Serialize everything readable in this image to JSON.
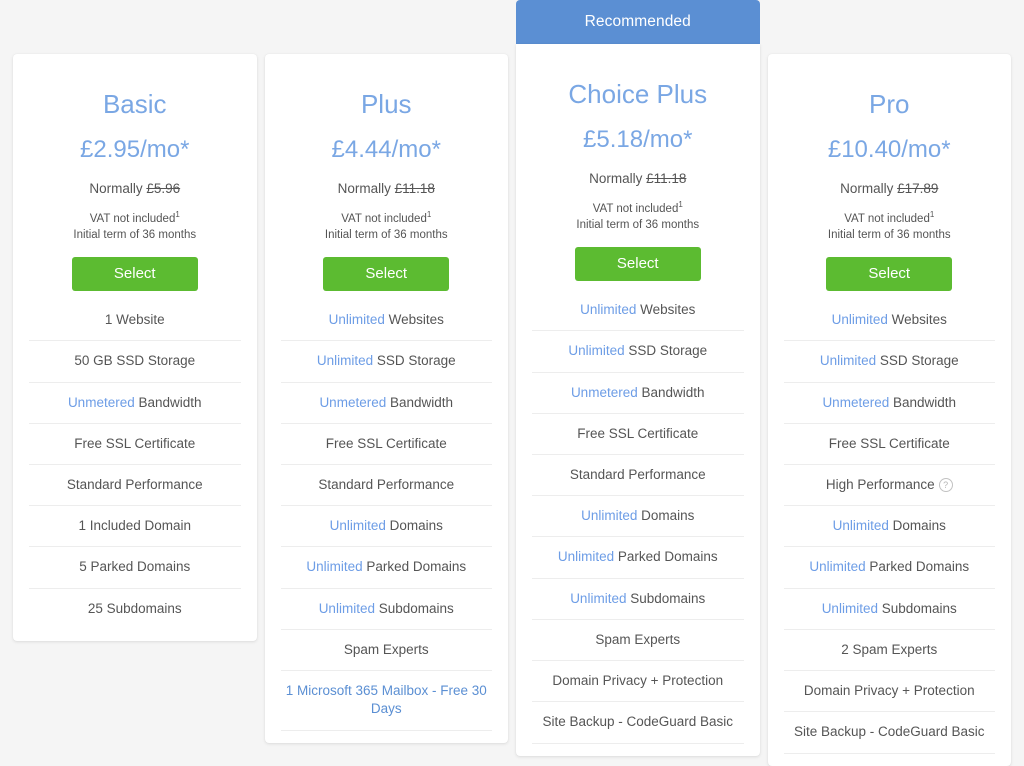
{
  "page": {
    "background_color": "#f5f5f5",
    "accent_blue": "#7aa7e4",
    "link_blue": "#6d9de6",
    "banner_blue": "#5b8fd3",
    "button_green": "#5cbb31",
    "body_text": "#555555"
  },
  "plans": [
    {
      "id": "basic",
      "name": "Basic",
      "price": "£2.95/mo*",
      "normally_label": "Normally",
      "normally_price": "£5.96",
      "vat_note": "VAT not included",
      "vat_superscript": "1",
      "term_note": "Initial term of 36 months",
      "select_label": "Select",
      "recommended": false,
      "banner_label": "",
      "features": [
        {
          "highlight": "",
          "text": "1 Website"
        },
        {
          "highlight": "",
          "text": "50 GB SSD Storage"
        },
        {
          "highlight": "Unmetered",
          "text": "Bandwidth"
        },
        {
          "highlight": "",
          "text": "Free SSL Certificate"
        },
        {
          "highlight": "",
          "text": "Standard Performance"
        },
        {
          "highlight": "",
          "text": "1 Included Domain"
        },
        {
          "highlight": "",
          "text": "5 Parked Domains"
        },
        {
          "highlight": "",
          "text": "25 Subdomains"
        }
      ]
    },
    {
      "id": "plus",
      "name": "Plus",
      "price": "£4.44/mo*",
      "normally_label": "Normally",
      "normally_price": "£11.18",
      "vat_note": "VAT not included",
      "vat_superscript": "1",
      "term_note": "Initial term of 36 months",
      "select_label": "Select",
      "recommended": false,
      "banner_label": "",
      "features": [
        {
          "highlight": "Unlimited",
          "text": "Websites"
        },
        {
          "highlight": "Unlimited",
          "text": "SSD Storage"
        },
        {
          "highlight": "Unmetered",
          "text": "Bandwidth"
        },
        {
          "highlight": "",
          "text": "Free SSL Certificate"
        },
        {
          "highlight": "",
          "text": "Standard Performance"
        },
        {
          "highlight": "Unlimited",
          "text": "Domains"
        },
        {
          "highlight": "Unlimited",
          "text": "Parked Domains"
        },
        {
          "highlight": "Unlimited",
          "text": "Subdomains"
        },
        {
          "highlight": "",
          "text": "Spam Experts"
        },
        {
          "highlight": "",
          "text": "1 Microsoft 365 Mailbox - Free 30 Days",
          "is_link": true
        }
      ]
    },
    {
      "id": "choice-plus",
      "name": "Choice Plus",
      "price": "£5.18/mo*",
      "normally_label": "Normally",
      "normally_price": "£11.18",
      "vat_note": "VAT not included",
      "vat_superscript": "1",
      "term_note": "Initial term of 36 months",
      "select_label": "Select",
      "recommended": true,
      "banner_label": "Recommended",
      "features": [
        {
          "highlight": "Unlimited",
          "text": "Websites"
        },
        {
          "highlight": "Unlimited",
          "text": "SSD Storage"
        },
        {
          "highlight": "Unmetered",
          "text": "Bandwidth"
        },
        {
          "highlight": "",
          "text": "Free SSL Certificate"
        },
        {
          "highlight": "",
          "text": "Standard Performance"
        },
        {
          "highlight": "Unlimited",
          "text": "Domains"
        },
        {
          "highlight": "Unlimited",
          "text": "Parked Domains"
        },
        {
          "highlight": "Unlimited",
          "text": "Subdomains"
        },
        {
          "highlight": "",
          "text": "Spam Experts"
        },
        {
          "highlight": "",
          "text": "Domain Privacy + Protection"
        },
        {
          "highlight": "",
          "text": "Site Backup - CodeGuard Basic"
        }
      ]
    },
    {
      "id": "pro",
      "name": "Pro",
      "price": "£10.40/mo*",
      "normally_label": "Normally",
      "normally_price": "£17.89",
      "vat_note": "VAT not included",
      "vat_superscript": "1",
      "term_note": "Initial term of 36 months",
      "select_label": "Select",
      "recommended": false,
      "banner_label": "",
      "features": [
        {
          "highlight": "Unlimited",
          "text": "Websites"
        },
        {
          "highlight": "Unlimited",
          "text": "SSD Storage"
        },
        {
          "highlight": "Unmetered",
          "text": "Bandwidth"
        },
        {
          "highlight": "",
          "text": "Free SSL Certificate"
        },
        {
          "highlight": "",
          "text": "High Performance",
          "help_icon": "help-circle-icon",
          "help_glyph": "?"
        },
        {
          "highlight": "Unlimited",
          "text": "Domains"
        },
        {
          "highlight": "Unlimited",
          "text": "Parked Domains"
        },
        {
          "highlight": "Unlimited",
          "text": "Subdomains"
        },
        {
          "highlight": "",
          "text": "2 Spam Experts"
        },
        {
          "highlight": "",
          "text": "Domain Privacy + Protection"
        },
        {
          "highlight": "",
          "text": "Site Backup - CodeGuard Basic"
        }
      ]
    }
  ]
}
